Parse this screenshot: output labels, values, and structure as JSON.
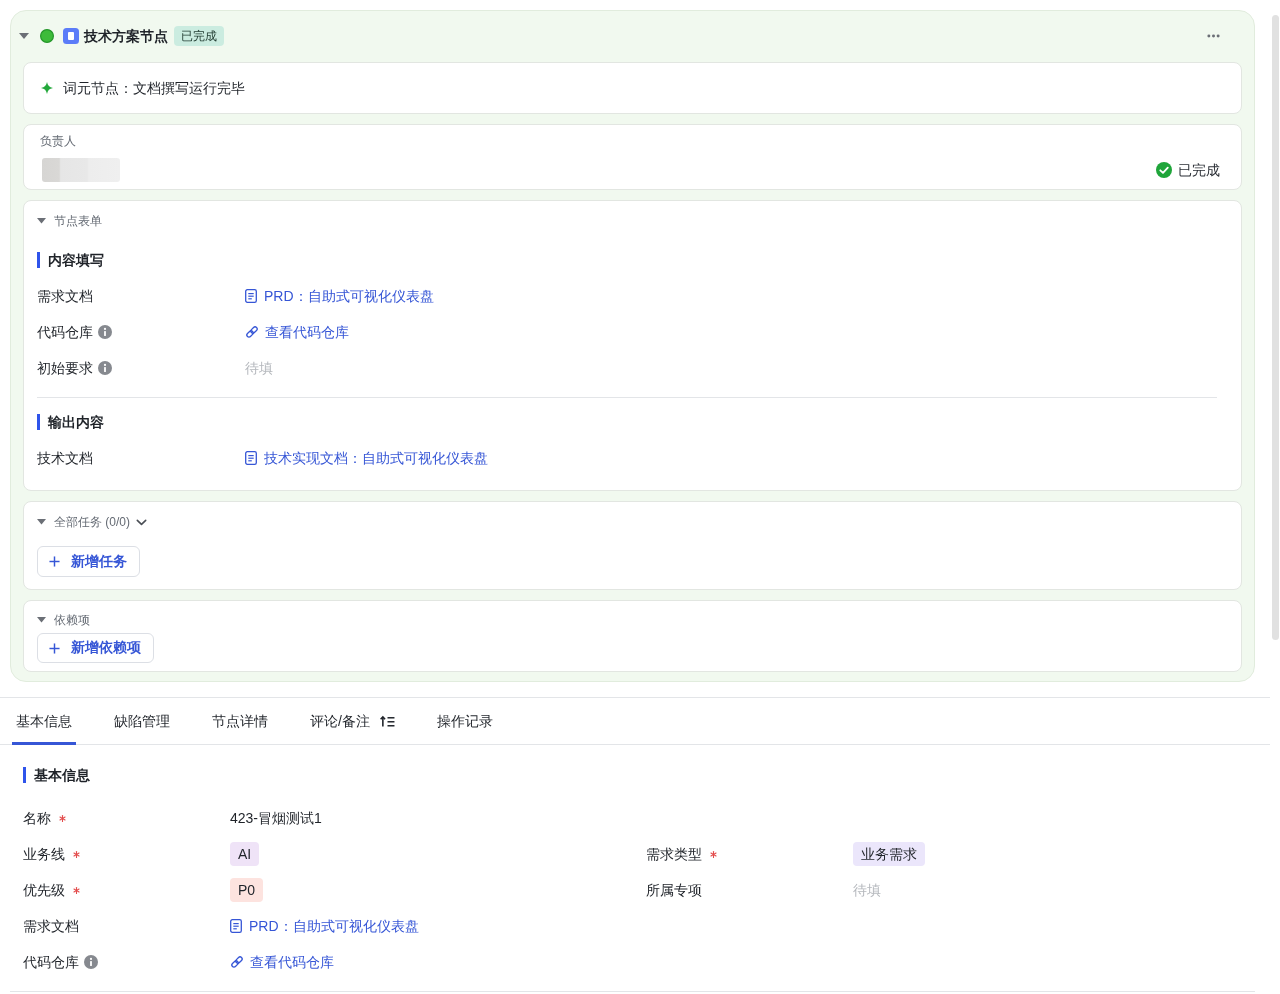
{
  "node": {
    "title": "技术方案节点",
    "status_badge": "已完成",
    "expanded": true
  },
  "message": {
    "text": "词元节点：文档撰写运行完毕"
  },
  "assignee": {
    "label": "负责人",
    "status": "已完成"
  },
  "form_panel": {
    "title": "节点表单",
    "expanded": true,
    "sections": [
      {
        "title": "内容填写",
        "rows": [
          {
            "label": "需求文档",
            "info": false,
            "value": {
              "kind": "doc",
              "text": "PRD：自助式可视化仪表盘"
            }
          },
          {
            "label": "代码仓库",
            "info": true,
            "value": {
              "kind": "link",
              "text": "查看代码仓库"
            }
          },
          {
            "label": "初始要求",
            "info": true,
            "value": {
              "kind": "empty",
              "text": "待填"
            }
          }
        ]
      },
      {
        "title": "输出内容",
        "rows": [
          {
            "label": "技术文档",
            "info": false,
            "value": {
              "kind": "doc",
              "text": "技术实现文档：自助式可视化仪表盘"
            }
          }
        ]
      }
    ]
  },
  "tasks_panel": {
    "title": "全部任务 (0/0)",
    "expanded": true,
    "add_button": "新增任务"
  },
  "dependencies_panel": {
    "title": "依赖项",
    "expanded": true,
    "add_button": "新增依赖项"
  },
  "tabs": [
    {
      "label": "基本信息",
      "selected": true,
      "kind": "plain"
    },
    {
      "label": "缺陷管理",
      "selected": false,
      "kind": "plain"
    },
    {
      "label": "节点详情",
      "selected": false,
      "kind": "plain"
    },
    {
      "label": "评论/备注",
      "selected": false,
      "kind": "sortable"
    },
    {
      "label": "操作记录",
      "selected": false,
      "kind": "plain"
    }
  ],
  "basic_info": {
    "title": "基本信息",
    "rows": [
      {
        "fields": [
          {
            "label": "名称",
            "required": true,
            "info": false,
            "value": {
              "kind": "text",
              "text": "423-冒烟测试1"
            }
          }
        ]
      },
      {
        "fields": [
          {
            "label": "业务线",
            "required": true,
            "info": false,
            "value": {
              "kind": "tag",
              "text": "AI",
              "color": "#efe3f7"
            }
          },
          {
            "label": "需求类型",
            "required": true,
            "info": false,
            "value": {
              "kind": "tag",
              "text": "业务需求",
              "color": "#ebe6fb"
            }
          }
        ]
      },
      {
        "fields": [
          {
            "label": "优先级",
            "required": true,
            "info": false,
            "value": {
              "kind": "tag",
              "text": "P0",
              "color": "#fde3df"
            }
          },
          {
            "label": "所属专项",
            "required": false,
            "info": false,
            "value": {
              "kind": "empty",
              "text": "待填"
            }
          }
        ]
      },
      {
        "fields": [
          {
            "label": "需求文档",
            "required": false,
            "info": false,
            "value": {
              "kind": "doc",
              "text": "PRD：自助式可视化仪表盘"
            }
          }
        ]
      },
      {
        "fields": [
          {
            "label": "代码仓库",
            "required": false,
            "info": true,
            "value": {
              "kind": "link",
              "text": "查看代码仓库"
            }
          }
        ]
      }
    ]
  }
}
